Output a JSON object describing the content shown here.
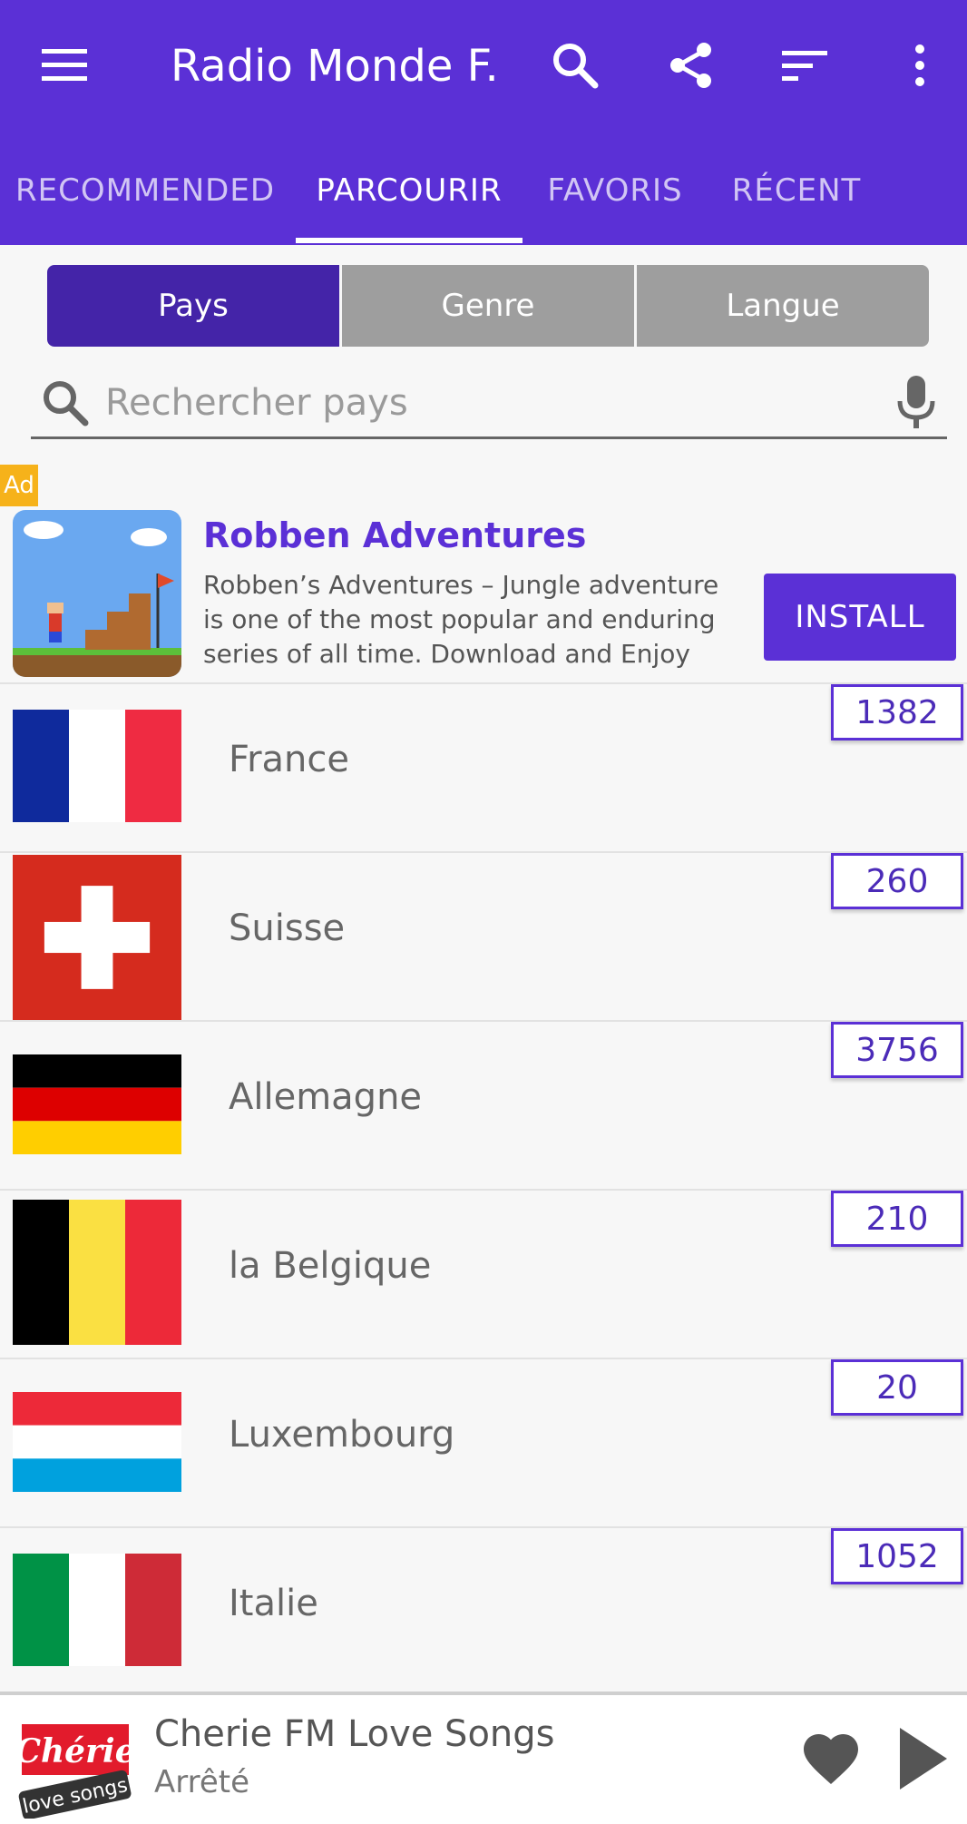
{
  "appbar": {
    "title": "Radio Monde F...",
    "icons": [
      "hamburger-menu-icon",
      "search-icon",
      "share-icon",
      "sort-icon",
      "more-vertical-icon"
    ]
  },
  "tabs": [
    {
      "label": "RECOMMENDED",
      "active": false
    },
    {
      "label": "PARCOURIR",
      "active": true
    },
    {
      "label": "FAVORIS",
      "active": false
    },
    {
      "label": "RÉCENT",
      "active": false
    }
  ],
  "segments": [
    {
      "label": "Pays",
      "active": true
    },
    {
      "label": "Genre",
      "active": false
    },
    {
      "label": "Langue",
      "active": false
    }
  ],
  "search": {
    "placeholder": "Rechercher pays",
    "value": ""
  },
  "ad": {
    "badge": "Ad",
    "title": "Robben Adventures",
    "description": "Robben’s Adventures – Jungle adventure is one of the most popular and enduring series of all time. Download and Enjoy",
    "cta": "INSTALL"
  },
  "countries": [
    {
      "name": "France",
      "count": "1382",
      "flag": "france"
    },
    {
      "name": "Suisse",
      "count": "260",
      "flag": "switzerland"
    },
    {
      "name": "Allemagne",
      "count": "3756",
      "flag": "germany"
    },
    {
      "name": "la Belgique",
      "count": "210",
      "flag": "belgium"
    },
    {
      "name": "Luxembourg",
      "count": "20",
      "flag": "luxembourg"
    },
    {
      "name": "Italie",
      "count": "1052",
      "flag": "italy"
    }
  ],
  "player": {
    "station": "Cherie FM Love Songs",
    "status": "Arrêté",
    "logo_text_top": "Chérie",
    "logo_text_bottom": "love songs"
  },
  "colors": {
    "primary": "#5b30d6",
    "segment_active": "#4424a8",
    "segment_inactive": "#9e9e9e",
    "ad_badge": "#f6b21a"
  }
}
